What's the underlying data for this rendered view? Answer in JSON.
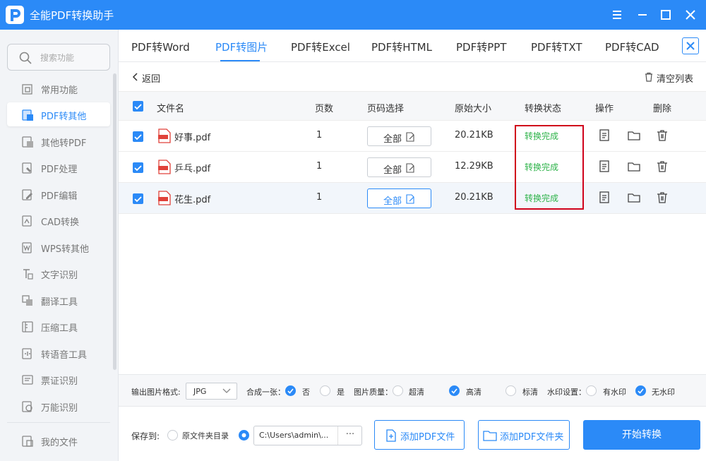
{
  "app": {
    "title": "全能PDF转换助手"
  },
  "sidebar": {
    "search_placeholder": "搜索功能",
    "items": [
      {
        "label": "常用功能",
        "icon": "common-icon"
      },
      {
        "label": "PDF转其他",
        "icon": "pdf-convert-icon",
        "active": true
      },
      {
        "label": "其他转PDF",
        "icon": "to-pdf-icon"
      },
      {
        "label": "PDF处理",
        "icon": "pdf-process-icon"
      },
      {
        "label": "PDF编辑",
        "icon": "pdf-edit-icon"
      },
      {
        "label": "CAD转换",
        "icon": "cad-icon"
      },
      {
        "label": "WPS转其他",
        "icon": "wps-icon"
      },
      {
        "label": "文字识别",
        "icon": "ocr-icon"
      },
      {
        "label": "翻译工具",
        "icon": "translate-icon"
      },
      {
        "label": "压缩工具",
        "icon": "compress-icon"
      },
      {
        "label": "转语音工具",
        "icon": "voice-icon"
      },
      {
        "label": "票证识别",
        "icon": "ticket-icon"
      },
      {
        "label": "万能识别",
        "icon": "universal-icon"
      }
    ],
    "my_files": "我的文件"
  },
  "tabs": [
    {
      "label": "PDF转Word"
    },
    {
      "label": "PDF转图片",
      "active": true
    },
    {
      "label": "PDF转Excel"
    },
    {
      "label": "PDF转HTML"
    },
    {
      "label": "PDF转PPT"
    },
    {
      "label": "PDF转TXT"
    },
    {
      "label": "PDF转CAD"
    }
  ],
  "toolbar": {
    "back": "返回",
    "clear": "清空列表"
  },
  "table": {
    "headers": [
      "文件名",
      "页数",
      "页码选择",
      "原始大小",
      "转换状态",
      "操作",
      "删除"
    ],
    "rows": [
      {
        "name": "好事.pdf",
        "pages": "1",
        "page_select": "全部",
        "size": "20.21KB",
        "status": "转换完成"
      },
      {
        "name": "乒乓.pdf",
        "pages": "1",
        "page_select": "全部",
        "size": "12.29KB",
        "status": "转换完成"
      },
      {
        "name": "花生.pdf",
        "pages": "1",
        "page_select": "全部",
        "size": "20.21KB",
        "status": "转换完成"
      }
    ]
  },
  "options": {
    "format_label": "输出图片格式:",
    "format_value": "JPG",
    "merge_label": "合成一张：",
    "merge_no": "否",
    "merge_yes": "是",
    "quality_label": "图片质量：",
    "quality_super": "超清",
    "quality_high": "高清",
    "quality_std": "标清",
    "watermark_label": "水印设置：",
    "watermark_yes": "有水印",
    "watermark_no": "无水印"
  },
  "footer": {
    "save_label": "保存到:",
    "orig_dir": "原文件夹目录",
    "path": "C:\\Users\\admin\\...",
    "more": "···",
    "add_file": "添加PDF文件",
    "add_folder": "添加PDF文件夹",
    "start": "开始转换"
  },
  "colors": {
    "accent": "#2b8af7",
    "success": "#2eb34a",
    "highlight_box": "#d0021b"
  }
}
